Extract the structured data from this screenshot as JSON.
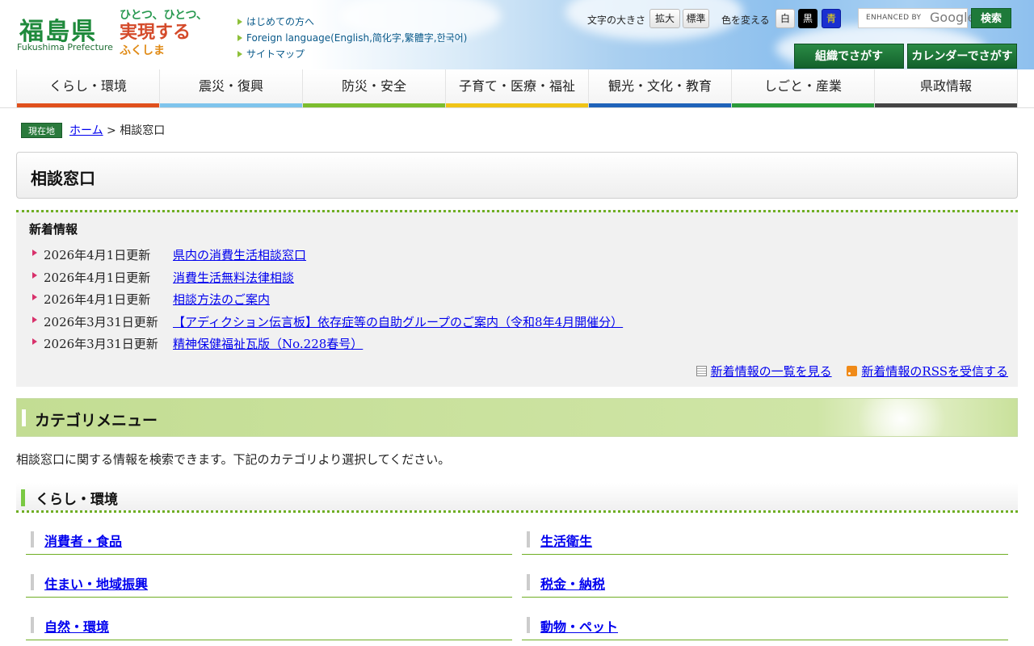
{
  "header": {
    "logo_name": "福島県",
    "logo_sub": "Fukushima Prefecture",
    "slogan_lines": [
      "ひとつ、ひとつ、",
      "実現する",
      "ふくしま"
    ],
    "util_links": [
      "はじめての方へ",
      "Foreign language(English,简化字,繁體字,한국어)",
      "サイトマップ"
    ],
    "text_size_label": "文字の大きさ",
    "text_size_up": "拡大",
    "text_size_default": "標準",
    "color_label": "色を変える",
    "color_white": "白",
    "color_black": "黒",
    "color_blue": "青",
    "search_enhanced": "ENHANCED BY",
    "search_google": "Google",
    "search_button": "検索",
    "org_search": "組織でさがす",
    "calendar_search": "カレンダーでさがす"
  },
  "gnav": [
    {
      "label": "くらし・環境",
      "color": "#e0501c"
    },
    {
      "label": "震災・復興",
      "color": "#7fc4ec"
    },
    {
      "label": "防災・安全",
      "color": "#7cbd2e"
    },
    {
      "label": "子育て・医療・福祉",
      "color": "#f0c417"
    },
    {
      "label": "観光・文化・教育",
      "color": "#1f63b9"
    },
    {
      "label": "しごと・産業",
      "color": "#2a9a3a"
    },
    {
      "label": "県政情報",
      "color": "#444444"
    }
  ],
  "breadcrumb": {
    "badge": "現在地",
    "home": "ホーム",
    "sep": ">",
    "current": "相談窓口"
  },
  "page_title": "相談窓口",
  "news": {
    "heading": "新着情報",
    "items": [
      {
        "date": "2026年4月1日更新",
        "title": "県内の消費生活相談窓口"
      },
      {
        "date": "2026年4月1日更新",
        "title": "消費生活無料法律相談"
      },
      {
        "date": "2026年4月1日更新",
        "title": "相談方法のご案内"
      },
      {
        "date": "2026年3月31日更新",
        "title": "【アディクション伝言板】依存症等の自助グループのご案内（令和8年4月開催分）"
      },
      {
        "date": "2026年3月31日更新",
        "title": "精神保健福祉瓦版（No.228春号）"
      }
    ],
    "list_link": "新着情報の一覧を見る",
    "rss_link": "新着情報のRSSを受信する"
  },
  "category": {
    "heading": "カテゴリメニュー",
    "description": "相談窓口に関する情報を検索できます。下記のカテゴリより選択してください。",
    "sub_heading": "くらし・環境",
    "items": [
      "消費者・食品",
      "生活衛生",
      "住まい・地域振興",
      "税金・納税",
      "自然・環境",
      "動物・ペット"
    ]
  }
}
